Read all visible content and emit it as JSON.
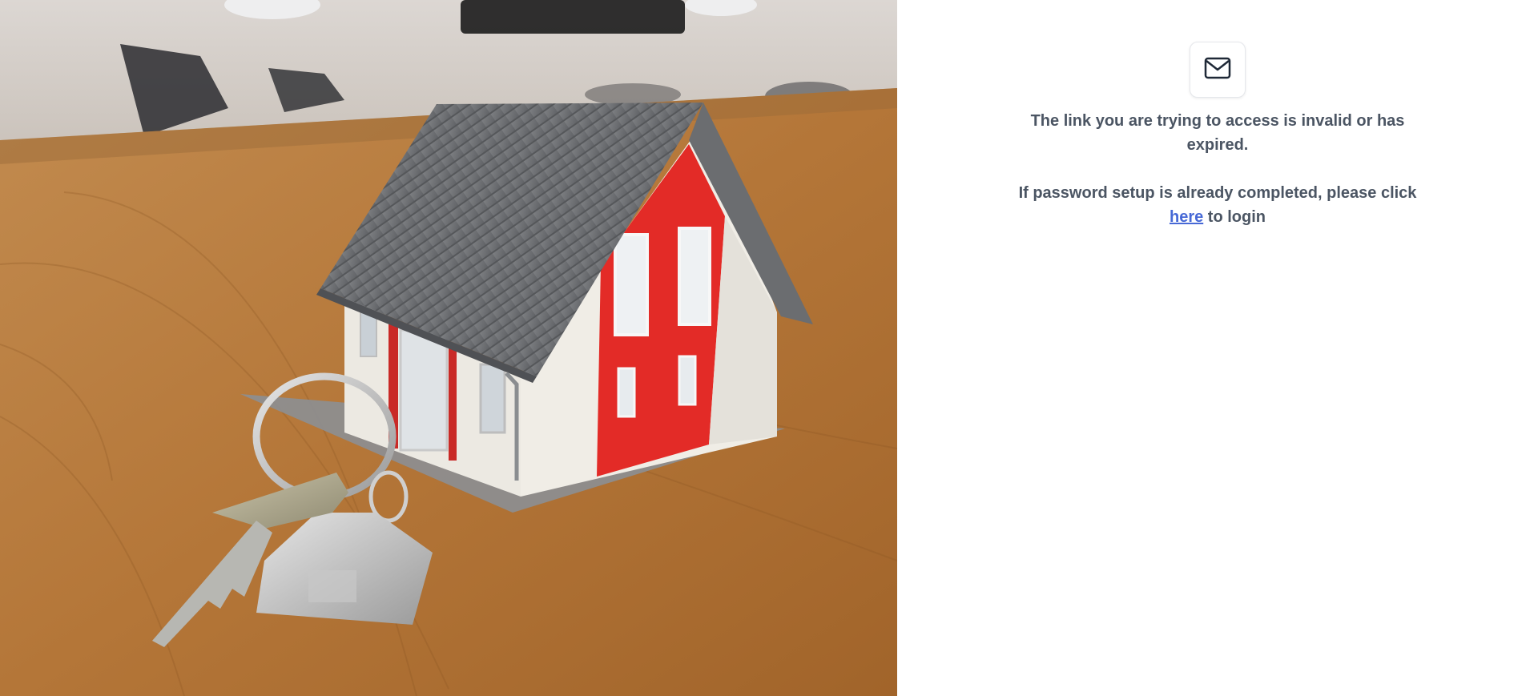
{
  "hero": {
    "image": "house-model-with-keys"
  },
  "message_panel": {
    "icon": "mail-icon",
    "invalid_link_text": "The link you are trying to access is invalid or has expired.",
    "login_prefix": "If password setup is already completed, please click",
    "login_link_label": "here",
    "login_suffix": "to login"
  },
  "colors": {
    "text": "#4b5563",
    "link": "#4769d6",
    "icon_stroke": "#1f2937"
  }
}
